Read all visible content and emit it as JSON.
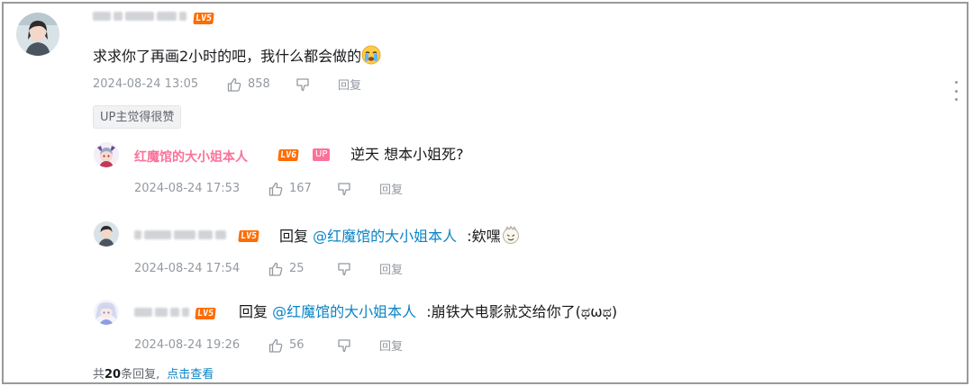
{
  "main_comment": {
    "avatar_icon": "user-avatar-icon",
    "level_badge": "LV5",
    "text": "求求你了再画2小时的吧，我什么都会做的",
    "emoji_icon": "crying-face-emoji-icon",
    "date": "2024-08-24 13:05",
    "likes": "858",
    "reply_label": "回复",
    "tag": "UP主觉得很赞"
  },
  "replies": [
    {
      "username": "红魔馆的大小姐本人",
      "level_badge": "LV6",
      "up_badge": "UP",
      "text": "逆天 想本小姐死?",
      "date": "2024-08-24 17:53",
      "likes": "167",
      "reply_label": "回复"
    },
    {
      "level_badge": "LV5",
      "reply_word": "回复",
      "mention": "@红魔馆的大小姐本人",
      "text": ":欸嘿",
      "emoji_icon": "cheeky-face-emoji-icon",
      "date": "2024-08-24 17:54",
      "likes": "25",
      "reply_label": "回复"
    },
    {
      "level_badge": "LV5",
      "reply_word": "回复",
      "mention": "@红魔馆的大小姐本人",
      "text": ":崩铁大电影就交给你了(ಥωಥ)",
      "date": "2024-08-24 19:26",
      "likes": "56",
      "reply_label": "回复"
    }
  ],
  "footer": {
    "prefix": "共",
    "count": "20",
    "suffix": "条回复,",
    "link": "点击查看"
  },
  "colors": {
    "mention": "#0a84c6",
    "up_name": "#fb7299",
    "level": "#ff6c00",
    "meta": "#9499a0"
  }
}
